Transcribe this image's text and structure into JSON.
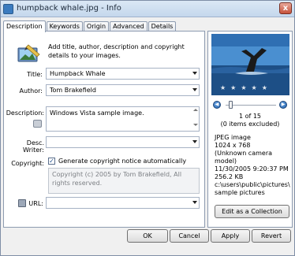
{
  "window": {
    "title": "humpback whale.jpg - Info",
    "close_label": "x"
  },
  "tabs": [
    {
      "label": "Description",
      "active": true
    },
    {
      "label": "Keywords",
      "active": false
    },
    {
      "label": "Origin",
      "active": false
    },
    {
      "label": "Advanced",
      "active": false
    },
    {
      "label": "Details",
      "active": false
    }
  ],
  "intro": {
    "text": "Add title, author, description and copyright details to your images."
  },
  "fields": {
    "title_label": "Title:",
    "title_value": "Humpback Whale",
    "author_label": "Author:",
    "author_value": "Tom Brakefield",
    "description_label": "Description:",
    "description_value": "Windows Vista sample image.",
    "desc_writer_label": "Desc. Writer:",
    "desc_writer_value": "",
    "copyright_label": "Copyright:",
    "copyright_checkbox_label": "Generate copyright notice automatically",
    "copyright_checked": true,
    "copyright_value": "Copyright (c) 2005 by Tom Brakefield, All rights reserved.",
    "url_label": "URL:",
    "url_value": ""
  },
  "preview": {
    "rating_stars": 5,
    "rating_filled": 0,
    "prev_icon": "skip-back-icon",
    "next_icon": "skip-forward-icon",
    "position_text": "1 of 15",
    "excluded_text": "(0 items excluded)",
    "file_type": "JPEG image",
    "dimensions": "1024 x 768",
    "camera": "(Unknown camera model)",
    "date": "11/30/2005 9:20:37 PM",
    "size": "256.2 KB",
    "path_line1": "c:\\users\\public\\pictures\\",
    "path_line2": "sample pictures",
    "collection_button": "Edit as a Collection"
  },
  "buttons": {
    "ok": "OK",
    "cancel": "Cancel",
    "apply": "Apply",
    "revert": "Revert"
  },
  "colors": {
    "sky": "#3a7fc4",
    "water": "#1d4f86"
  }
}
